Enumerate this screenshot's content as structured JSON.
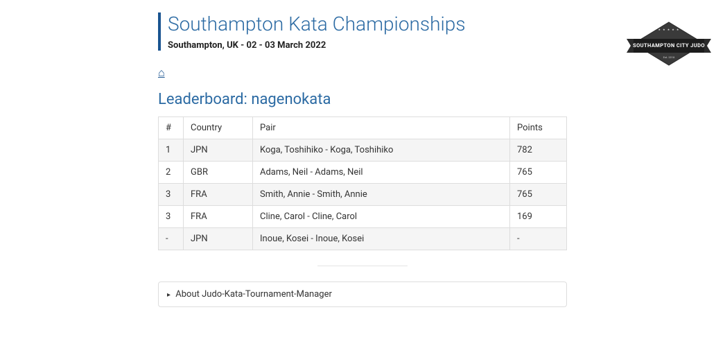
{
  "header": {
    "title": "Southampton Kata Championships",
    "subtitle": "Southampton, UK - 02 - 03 March 2022"
  },
  "nav": {
    "home_icon": "⌂"
  },
  "leaderboard": {
    "heading": "Leaderboard: nagenokata",
    "columns": {
      "rank": "#",
      "country": "Country",
      "pair": "Pair",
      "points": "Points"
    },
    "rows": [
      {
        "rank": "1",
        "country": "JPN",
        "pair": "Koga, Toshihiko - Koga, Toshihiko",
        "points": "782"
      },
      {
        "rank": "2",
        "country": "GBR",
        "pair": "Adams, Neil - Adams, Neil",
        "points": "765"
      },
      {
        "rank": "3",
        "country": "FRA",
        "pair": "Smith, Annie - Smith, Annie",
        "points": "765"
      },
      {
        "rank": "3",
        "country": "FRA",
        "pair": "Cline, Carol - Cline, Carol",
        "points": "169"
      },
      {
        "rank": "-",
        "country": "JPN",
        "pair": "Inoue, Kosei - Inoue, Kosei",
        "points": "-"
      }
    ]
  },
  "about": {
    "label": "About Judo-Kata-Tournament-Manager"
  },
  "logo": {
    "line1": "SOUTHAMPTON CITY JUDO",
    "line2": "Est. 2018",
    "stars": "★ ★ ★ ★ ★"
  }
}
